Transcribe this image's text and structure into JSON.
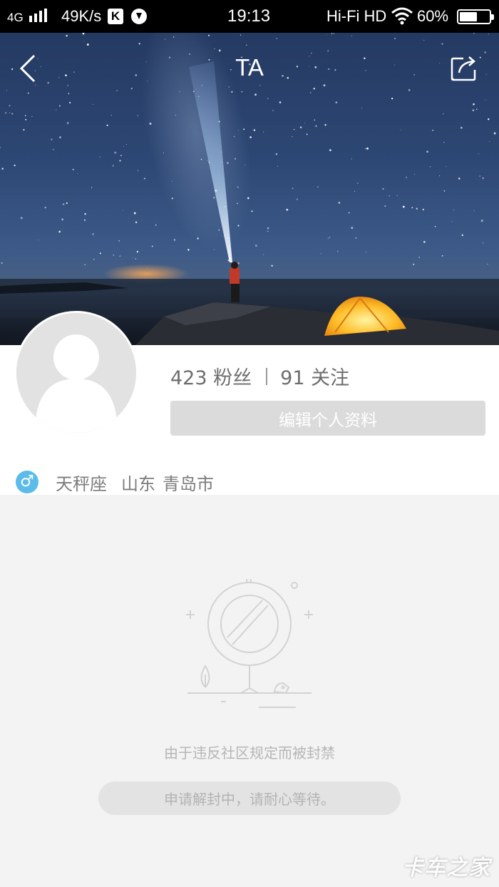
{
  "status_bar": {
    "network": "4G",
    "speed": "49K/s",
    "k_badge": "K",
    "time": "19:13",
    "hifi": "Hi-Fi  HD",
    "battery_pct": "60%",
    "battery_level": 0.6
  },
  "header": {
    "title": "TA",
    "back_icon": "chevron-left-icon",
    "share_icon": "share-icon"
  },
  "profile": {
    "fans_count": "423",
    "fans_label": "粉丝",
    "follow_count": "91",
    "follow_label": "关注",
    "edit_button": "编辑个人资料",
    "gender_icon": "male-icon",
    "gender_symbol": "♂",
    "zodiac": "天秤座",
    "province": "山东",
    "city": "青岛市"
  },
  "empty_state": {
    "illustration": "banned-sign-icon",
    "message": "由于违反社区规定而被封禁",
    "appeal_status": "申请解封中，请耐心等待。"
  },
  "watermark": "卡车之家",
  "colors": {
    "accent_blue": "#5bbbe9",
    "button_gray": "#dbdbdb",
    "background": "#f3f3f3"
  }
}
